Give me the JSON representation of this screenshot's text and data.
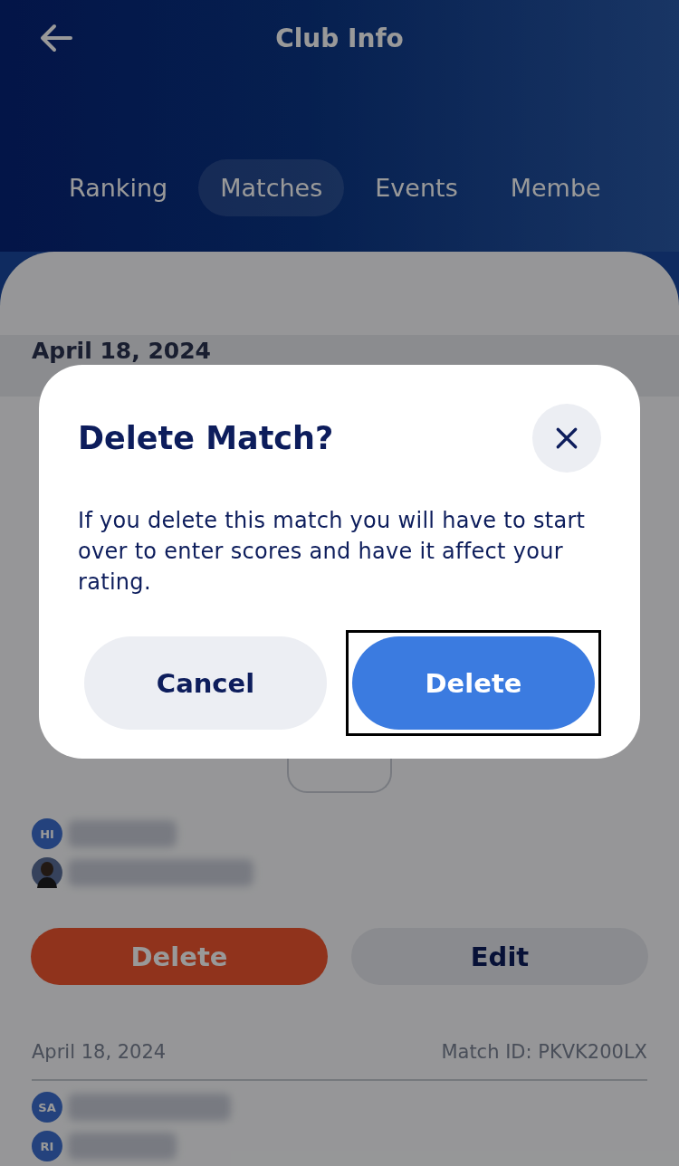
{
  "header": {
    "title": "Club Info"
  },
  "tabs": [
    {
      "label": "Ranking",
      "selected": false
    },
    {
      "label": "Matches",
      "selected": true
    },
    {
      "label": "Events",
      "selected": false
    },
    {
      "label": "Membe",
      "selected": false
    }
  ],
  "sticky_date": "April 18, 2024",
  "match_1": {
    "team_b": [
      {
        "initials": "HI",
        "kind": "initials"
      },
      {
        "kind": "photo"
      }
    ],
    "buttons": [
      {
        "label": "Delete",
        "kind": "danger"
      },
      {
        "label": "Edit",
        "kind": "secondary"
      }
    ]
  },
  "match_2": {
    "date": "April 18, 2024",
    "match_id": "Match ID: PKVK200LX",
    "team_a": [
      {
        "initials": "SA",
        "kind": "initials"
      },
      {
        "initials": "RI",
        "kind": "initials"
      }
    ]
  },
  "dialog": {
    "title": "Delete Match?",
    "message": "If you delete this match you will have to start over to enter scores and have it affect your rating.",
    "buttons": [
      {
        "label": "Cancel",
        "kind": "secondary",
        "focused": false
      },
      {
        "label": "Delete",
        "kind": "primary",
        "focused": true
      }
    ]
  }
}
